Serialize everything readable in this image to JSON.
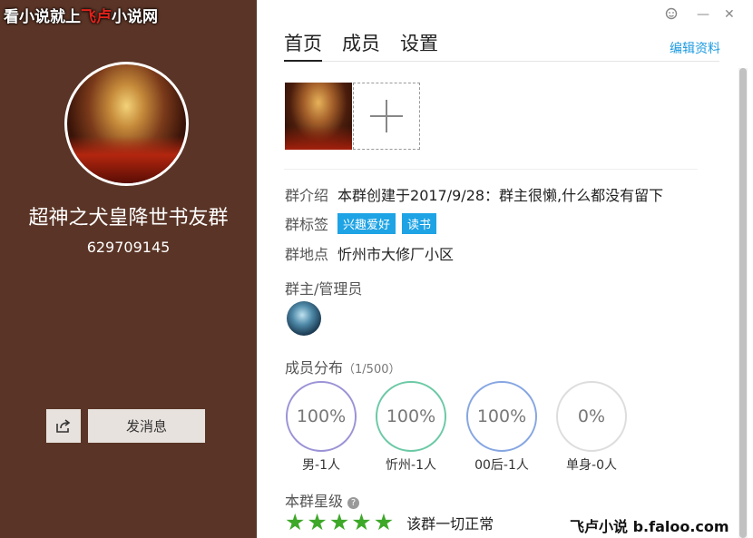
{
  "watermark": {
    "part1": "看小说就上",
    "part2": "飞卢",
    "part3": "小说网"
  },
  "left": {
    "group_name": "超神之犬皇降世书友群",
    "group_id": "629709145",
    "share_icon": "share-icon",
    "message_button": "发消息"
  },
  "window": {
    "skin_icon": "skin-icon",
    "minimize": "—",
    "close": "✕"
  },
  "tabs": [
    {
      "label": "首页",
      "active": true
    },
    {
      "label": "成员"
    },
    {
      "label": "设置"
    }
  ],
  "edit_link": "编辑资料",
  "info": {
    "intro_label": "群介绍",
    "intro_value": "本群创建于2017/9/28：群主很懒,什么都没有留下",
    "tags_label": "群标签",
    "tags": [
      "兴趣爱好",
      "读书"
    ],
    "location_label": "群地点",
    "location_value": "忻州市大修厂小区"
  },
  "admins_title": "群主/管理员",
  "members": {
    "title": "成员分布",
    "count": "（1/500）",
    "stats": [
      {
        "value": "100%",
        "label": "男-1人",
        "color": "#9b93d6"
      },
      {
        "value": "100%",
        "label": "忻州-1人",
        "color": "#6cc9a6"
      },
      {
        "value": "100%",
        "label": "00后-1人",
        "color": "#86a6e2"
      },
      {
        "value": "0%",
        "label": "单身-0人",
        "color": "#dddddd"
      }
    ]
  },
  "rating": {
    "title": "本群星级",
    "stars": 5,
    "status": "该群一切正常"
  },
  "brand": "飞卢小说  b.faloo.com"
}
